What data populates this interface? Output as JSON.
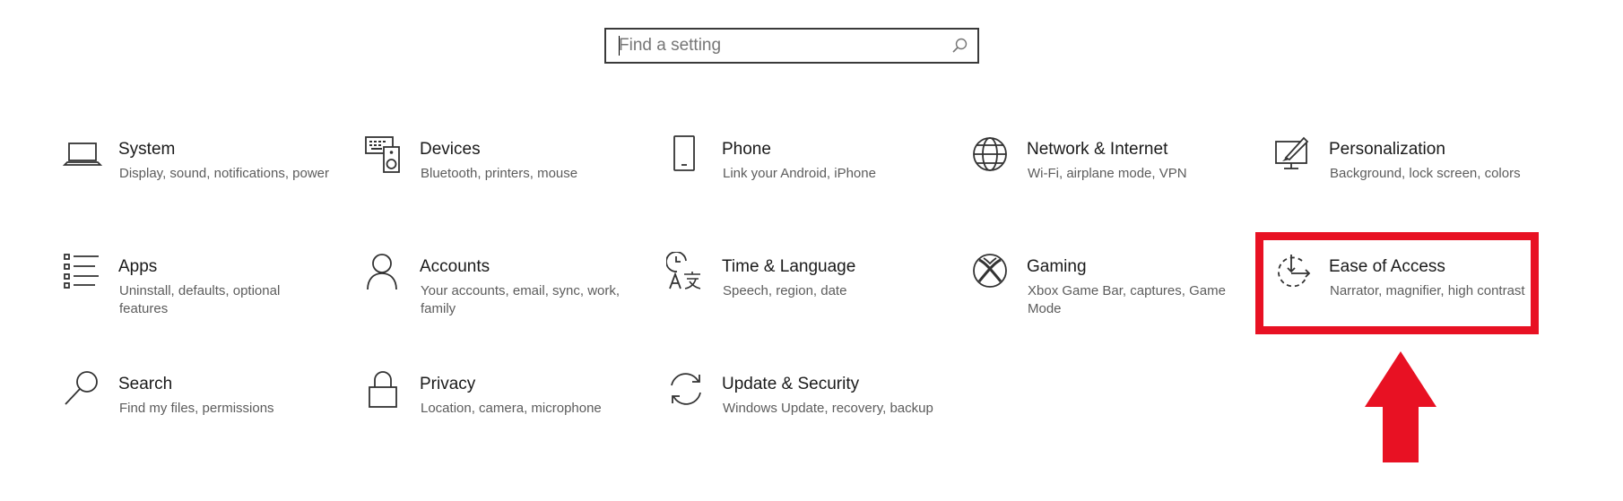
{
  "search": {
    "placeholder": "Find a setting",
    "icon": "search-icon"
  },
  "tiles": [
    {
      "title": "System",
      "description": "Display, sound, notifications, power",
      "icon": "laptop-icon"
    },
    {
      "title": "Devices",
      "description": "Bluetooth, printers, mouse",
      "icon": "devices-icon"
    },
    {
      "title": "Phone",
      "description": "Link your Android, iPhone",
      "icon": "phone-icon"
    },
    {
      "title": "Network & Internet",
      "description": "Wi-Fi, airplane mode, VPN",
      "icon": "globe-icon"
    },
    {
      "title": "Personalization",
      "description": "Background, lock screen, colors",
      "icon": "personalization-icon"
    },
    {
      "title": "Apps",
      "description": "Uninstall, defaults, optional features",
      "icon": "apps-list-icon"
    },
    {
      "title": "Accounts",
      "description": "Your accounts, email, sync, work, family",
      "icon": "person-icon"
    },
    {
      "title": "Time & Language",
      "description": "Speech, region, date",
      "icon": "time-language-icon"
    },
    {
      "title": "Gaming",
      "description": "Xbox Game Bar, captures, Game Mode",
      "icon": "xbox-icon"
    },
    {
      "title": "Ease of Access",
      "description": "Narrator, magnifier, high contrast",
      "icon": "ease-of-access-icon"
    },
    {
      "title": "Search",
      "description": "Find my files, permissions",
      "icon": "magnifier-icon"
    },
    {
      "title": "Privacy",
      "description": "Location, camera, microphone",
      "icon": "lock-icon"
    },
    {
      "title": "Update & Security",
      "description": "Windows Update, recovery, backup",
      "icon": "sync-icon"
    }
  ],
  "annotation": {
    "highlight_color": "#e81123",
    "highlighted_tile": "Ease of Access"
  }
}
